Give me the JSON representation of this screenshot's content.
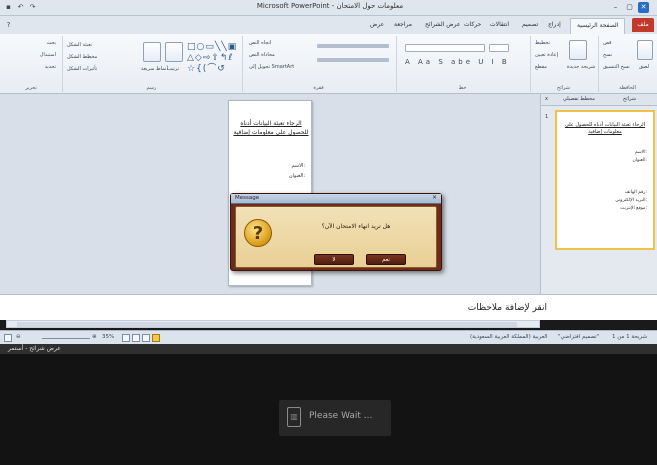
{
  "window": {
    "title": "Microsoft PowerPoint - معلومات حول الامتحان",
    "quick_access": [
      "save",
      "undo",
      "redo"
    ]
  },
  "ribbon": {
    "tabs": [
      {
        "label": "ملف",
        "key": "file"
      },
      {
        "label": "الصفحة الرئيسية",
        "key": "home"
      },
      {
        "label": "إدراج",
        "key": "insert"
      },
      {
        "label": "تصميم",
        "key": "design"
      },
      {
        "label": "انتقالات",
        "key": "transitions"
      },
      {
        "label": "حركات",
        "key": "animations"
      },
      {
        "label": "عرض الشرائح",
        "key": "slideshow"
      },
      {
        "label": "مراجعة",
        "key": "review"
      },
      {
        "label": "عرض",
        "key": "view"
      }
    ],
    "groups": [
      {
        "label": "الحافظة"
      },
      {
        "label": "شرائح"
      },
      {
        "label": "خط"
      },
      {
        "label": "فقرة"
      },
      {
        "label": "رسم"
      },
      {
        "label": "تحرير"
      }
    ],
    "buttons": {
      "paste": "لصق",
      "cut": "قص",
      "copy": "نسخ",
      "format_painter": "نسخ التنسيق",
      "new_slide": "شريحة جديدة",
      "layout": "تخطيط",
      "reset": "إعادة تعيين",
      "section": "مقطع",
      "text_direction": "اتجاه النص",
      "align_text": "محاذاة النص",
      "smartart": "تحويل إلى SmartArt",
      "arrange": "ترتيب",
      "quick_styles": "أنماط سريعة",
      "shape_fill": "تعبئة الشكل",
      "shape_outline": "مخطط الشكل",
      "shape_effects": "تأثيرات الشكل",
      "find": "بحث",
      "replace": "استبدال",
      "select": "تحديد"
    }
  },
  "slide": {
    "title": "الرجاء تعبئة البيانات أدناه للحصول على معلومات إضافية",
    "lines": [
      "الاسم:",
      "العنوان:"
    ]
  },
  "pane": {
    "tabs": [
      "شرائح",
      "مخطط تفصيلي"
    ],
    "close": "x",
    "thumb_title": "الرجاء تعبئة البيانات أدناه للحصول على معلومات إضافية",
    "thumb_lines": [
      "الاسم:",
      "العنوان:",
      "رقم الهاتف:",
      "البريد الإلكتروني:",
      "موقع الإنترنت:"
    ],
    "thumb_number": "1"
  },
  "dialog": {
    "title": "Message",
    "close": "×",
    "icon": "question-icon",
    "message": "هل تريد انهاء الامتحان الآن؟",
    "yes": "نعم",
    "no": "لا"
  },
  "notes": {
    "placeholder": "انقر لإضافة ملاحظات"
  },
  "status": {
    "slide_info": "شريحة 1 من 1",
    "theme": "\"تصميم افتراضي\"",
    "language": "العربية (المملكة العربية السعودية)",
    "zoom": "35%"
  },
  "darkbar": {
    "label": "عرض شرائح - أستمر"
  },
  "wait": {
    "text": "Please Wait ..."
  },
  "colors": {
    "file_tab": "#c0392b",
    "dialog_frame": "#6d2b1c",
    "dialog_body": "#f2e1b7",
    "thumb_border": "#f0c24b"
  }
}
